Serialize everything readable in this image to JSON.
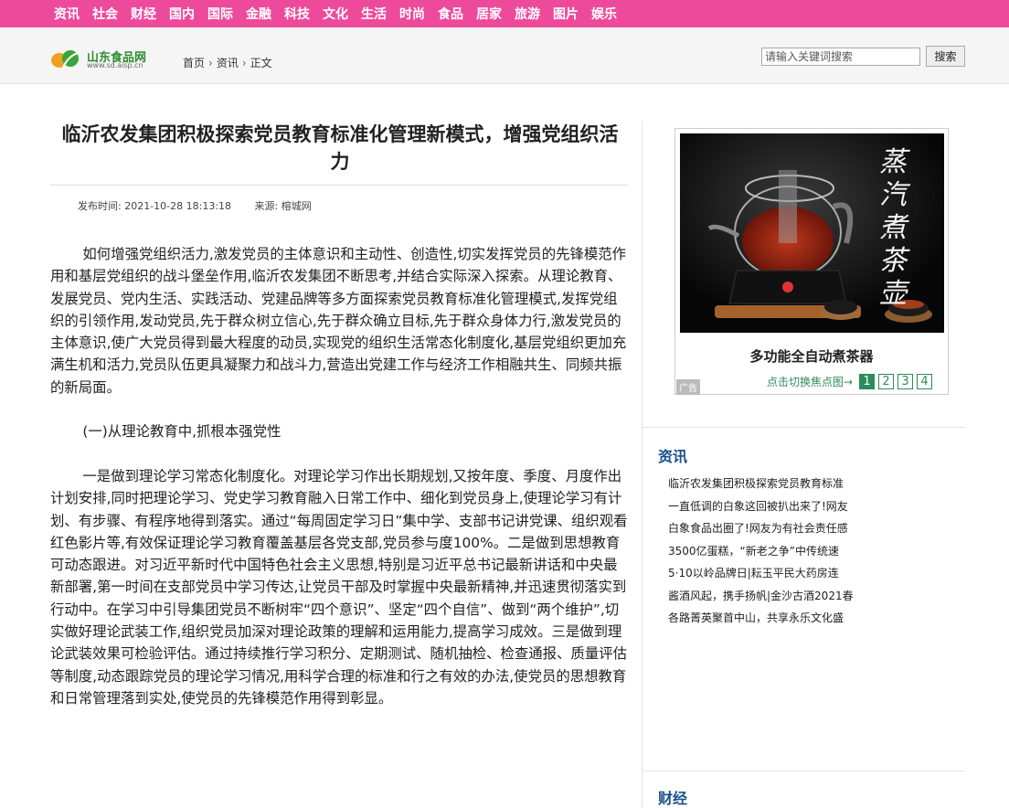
{
  "nav": {
    "items": [
      "资讯",
      "社会",
      "财经",
      "国内",
      "国际",
      "金融",
      "科技",
      "文化",
      "生活",
      "时尚",
      "食品",
      "居家",
      "旅游",
      "图片",
      "娱乐"
    ]
  },
  "header": {
    "logo_name": "山东食品网",
    "logo_url": "www.sd.aisp.cn",
    "breadcrumb": [
      "首页",
      "资讯",
      "正文"
    ],
    "search_placeholder": "请输入关键词搜索",
    "search_button": "搜索"
  },
  "article": {
    "title": "临沂农发集团积极探索党员教育标准化管理新模式，增强党组织活力",
    "publish_time": "发布时间: 2021-10-28 18:13:18",
    "source": "来源: 榕城网",
    "paragraphs": [
      "如何增强党组织活力,激发党员的主体意识和主动性、创造性,切实发挥党员的先锋模范作用和基层党组织的战斗堡垒作用,临沂农发集团不断思考,并结合实际深入探索。从理论教育、发展党员、党内生活、实践活动、党建品牌等多方面探索党员教育标准化管理模式,发挥党组织的引领作用,发动党员,先于群众树立信心,先于群众确立目标,先于群众身体力行,激发党员的主体意识,使广大党员得到最大程度的动员,实现党的组织生活常态化制度化,基层党组织更加充满生机和活力,党员队伍更具凝聚力和战斗力,营造出党建工作与经济工作相融共生、同频共振的新局面。",
      "(一)从理论教育中,抓根本强党性",
      "一是做到理论学习常态化制度化。对理论学习作出长期规划,又按年度、季度、月度作出计划安排,同时把理论学习、党史学习教育融入日常工作中、细化到党员身上,使理论学习有计划、有步骤、有程序地得到落实。通过“每周固定学习日”集中学、支部书记讲党课、组织观看红色影片等,有效保证理论学习教育覆盖基层各党支部,党员参与度100%。二是做到思想教育可动态跟进。对习近平新时代中国特色社会主义思想,特别是习近平总书记最新讲话和中央最新部署,第一时间在支部党员中学习传达,让党员干部及时掌握中央最新精神,并迅速贯彻落实到行动中。在学习中引导集团党员不断树牢“四个意识”、坚定“四个自信”、做到“两个维护”,切实做好理论武装工作,组织党员加深对理论政策的理解和运用能力,提高学习成效。三是做到理论武装效果可检验评估。通过持续推行学习积分、定期测试、随机抽检、检查通报、质量评估等制度,动态跟踪党员的理论学习情况,用科学合理的标准和行之有效的办法,使党员的思想教育和日常管理落到实处,使党员的先锋模范作用得到彰显。"
    ]
  },
  "ad": {
    "image_text": "蒸汽煮茶壶",
    "caption": "多功能全自动煮茶器",
    "switch_label": "点击切换焦点图→",
    "pages": [
      "1",
      "2",
      "3",
      "4"
    ],
    "active_page": "1",
    "tag": "广告"
  },
  "sidebar": {
    "section_title": "资讯",
    "items": [
      "临沂农发集团积极探索党员教育标准",
      "一直低调的白象这回被扒出来了!网友",
      "白象食品出圈了!网友为有社会责任感",
      "3500亿蛋糕，“新老之争”中传统速",
      "5·10以岭品牌日|耘玉平民大药房连",
      "酱酒风起，携手扬帆|金沙古酒2021春",
      "各路菁英聚首中山，共享永乐文化盛"
    ],
    "section_title_2": "财经"
  },
  "colors": {
    "nav_bg": "#ee4a9b",
    "link_blue": "#1a4f8c",
    "ad_green": "#2c8c5a"
  }
}
